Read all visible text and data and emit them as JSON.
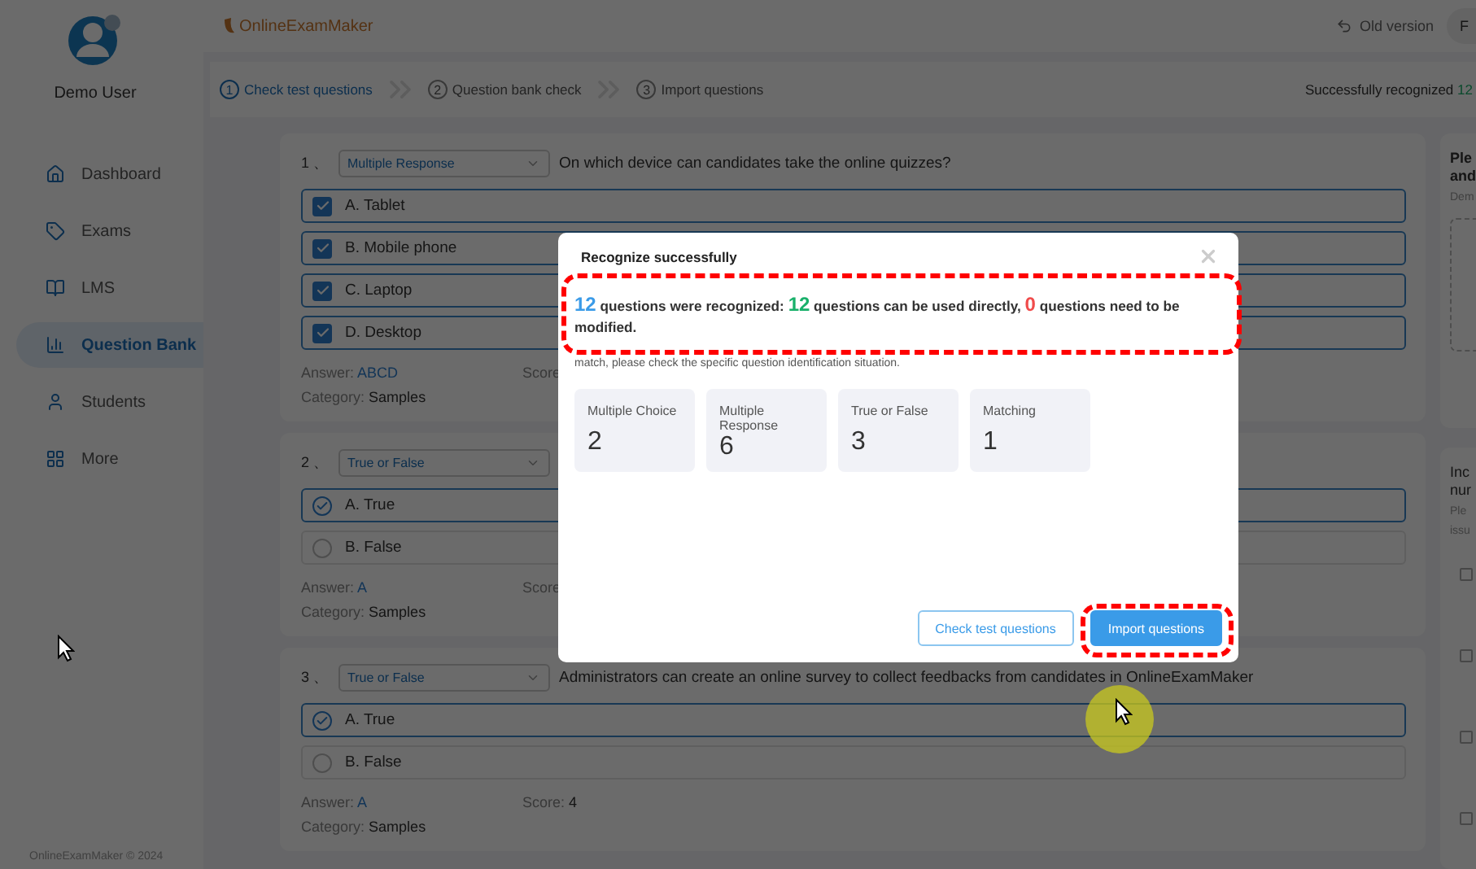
{
  "sidebar": {
    "user_name": "Demo User",
    "items": [
      {
        "label": "Dashboard",
        "selected": false
      },
      {
        "label": "Exams",
        "selected": false
      },
      {
        "label": "LMS",
        "selected": false
      },
      {
        "label": "Question Bank",
        "selected": true
      },
      {
        "label": "Students",
        "selected": false
      },
      {
        "label": "More",
        "selected": false
      }
    ],
    "footer": "OnlineExamMaker © 2024"
  },
  "header": {
    "logo": "OnlineExamMaker",
    "old_version": "Old version",
    "cut_button": "F"
  },
  "steps": [
    {
      "number": "1",
      "label": "Check test questions",
      "selected": true
    },
    {
      "number": "2",
      "label": "Question bank check",
      "selected": false
    },
    {
      "number": "3",
      "label": "Import questions",
      "selected": false
    }
  ],
  "recognized": {
    "label": "Successfully recognized",
    "count": "12"
  },
  "questions": [
    {
      "number": "1 、",
      "type": "Multiple Response",
      "kind": "checkbox",
      "text": "On which device can candidates take the online quizzes?",
      "options": [
        {
          "label": "A. Tablet",
          "checked": true
        },
        {
          "label": "B. Mobile phone",
          "checked": true
        },
        {
          "label": "C. Laptop",
          "checked": true
        },
        {
          "label": "D. Desktop",
          "checked": true
        }
      ],
      "answer_label": "Answer:",
      "answer": "ABCD",
      "score_label": "Score",
      "category_label": "Category:",
      "category": "Samples"
    },
    {
      "number": "2 、",
      "type": "True or False",
      "kind": "radio",
      "options": [
        {
          "label": "A. True",
          "checked": true
        },
        {
          "label": "B. False",
          "checked": false
        }
      ],
      "answer_label": "Answer:",
      "answer": "A",
      "score_label": "Score",
      "category_label": "Category:",
      "category": "Samples"
    },
    {
      "number": "3 、",
      "type": "True or False",
      "kind": "radio",
      "text": "Administrators can create an online survey to collect feedbacks from candidates in OnlineExamMaker",
      "options": [
        {
          "label": "A. True",
          "checked": true
        },
        {
          "label": "B. False",
          "checked": false
        }
      ],
      "answer_label": "Answer:",
      "answer": "A",
      "score_label": "Score:",
      "score": "4",
      "category_label": "Category:",
      "category": "Samples"
    }
  ],
  "side_cards": [
    {
      "kind": "upload",
      "title_lines": [
        "Ple",
        "and"
      ],
      "subtitle_lines": [
        "Dem"
      ]
    },
    {
      "kind": "checklist",
      "title_lines": [
        "Inc",
        "nur"
      ],
      "subtitle_lines": [
        "Ple",
        "issu"
      ],
      "checkboxes": [
        {
          "checked": false
        },
        {
          "checked": false
        },
        {
          "checked": false
        },
        {
          "checked": false
        }
      ]
    }
  ],
  "modal": {
    "title": "Recognize successfully",
    "summary": [
      {
        "kind": "total",
        "text": "12"
      },
      {
        "kind": "plain",
        "text": " questions were recognized: "
      },
      {
        "kind": "ok",
        "text": "12"
      },
      {
        "kind": "plain",
        "text": " questions can be used directly, "
      },
      {
        "kind": "error",
        "text": "0"
      },
      {
        "kind": "plain",
        "text": " questions need to be modified."
      }
    ],
    "note": "match, please check the specific question identification situation.",
    "stats": [
      {
        "label": "Multiple Choice",
        "value": "2"
      },
      {
        "label": "Multiple Response",
        "value": "6"
      },
      {
        "label": "True or False",
        "value": "3"
      },
      {
        "label": "Matching",
        "value": "1"
      }
    ],
    "buttons": [
      {
        "label": "Check test questions",
        "kind": "secondary"
      },
      {
        "label": "Import questions",
        "kind": "primary"
      }
    ]
  }
}
